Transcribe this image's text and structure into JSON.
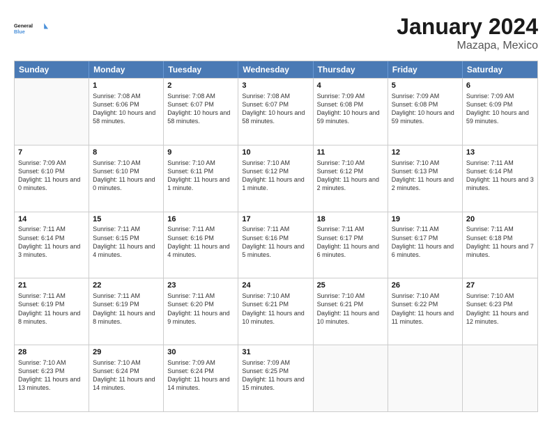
{
  "header": {
    "logo_general": "General",
    "logo_blue": "Blue",
    "main_title": "January 2024",
    "sub_title": "Mazapa, Mexico"
  },
  "days_of_week": [
    "Sunday",
    "Monday",
    "Tuesday",
    "Wednesday",
    "Thursday",
    "Friday",
    "Saturday"
  ],
  "weeks": [
    [
      {
        "day": "",
        "empty": true
      },
      {
        "day": "1",
        "sunrise": "Sunrise: 7:08 AM",
        "sunset": "Sunset: 6:06 PM",
        "daylight": "Daylight: 10 hours and 58 minutes."
      },
      {
        "day": "2",
        "sunrise": "Sunrise: 7:08 AM",
        "sunset": "Sunset: 6:07 PM",
        "daylight": "Daylight: 10 hours and 58 minutes."
      },
      {
        "day": "3",
        "sunrise": "Sunrise: 7:08 AM",
        "sunset": "Sunset: 6:07 PM",
        "daylight": "Daylight: 10 hours and 58 minutes."
      },
      {
        "day": "4",
        "sunrise": "Sunrise: 7:09 AM",
        "sunset": "Sunset: 6:08 PM",
        "daylight": "Daylight: 10 hours and 59 minutes."
      },
      {
        "day": "5",
        "sunrise": "Sunrise: 7:09 AM",
        "sunset": "Sunset: 6:08 PM",
        "daylight": "Daylight: 10 hours and 59 minutes."
      },
      {
        "day": "6",
        "sunrise": "Sunrise: 7:09 AM",
        "sunset": "Sunset: 6:09 PM",
        "daylight": "Daylight: 10 hours and 59 minutes."
      }
    ],
    [
      {
        "day": "7",
        "sunrise": "Sunrise: 7:09 AM",
        "sunset": "Sunset: 6:10 PM",
        "daylight": "Daylight: 11 hours and 0 minutes."
      },
      {
        "day": "8",
        "sunrise": "Sunrise: 7:10 AM",
        "sunset": "Sunset: 6:10 PM",
        "daylight": "Daylight: 11 hours and 0 minutes."
      },
      {
        "day": "9",
        "sunrise": "Sunrise: 7:10 AM",
        "sunset": "Sunset: 6:11 PM",
        "daylight": "Daylight: 11 hours and 1 minute."
      },
      {
        "day": "10",
        "sunrise": "Sunrise: 7:10 AM",
        "sunset": "Sunset: 6:12 PM",
        "daylight": "Daylight: 11 hours and 1 minute."
      },
      {
        "day": "11",
        "sunrise": "Sunrise: 7:10 AM",
        "sunset": "Sunset: 6:12 PM",
        "daylight": "Daylight: 11 hours and 2 minutes."
      },
      {
        "day": "12",
        "sunrise": "Sunrise: 7:10 AM",
        "sunset": "Sunset: 6:13 PM",
        "daylight": "Daylight: 11 hours and 2 minutes."
      },
      {
        "day": "13",
        "sunrise": "Sunrise: 7:11 AM",
        "sunset": "Sunset: 6:14 PM",
        "daylight": "Daylight: 11 hours and 3 minutes."
      }
    ],
    [
      {
        "day": "14",
        "sunrise": "Sunrise: 7:11 AM",
        "sunset": "Sunset: 6:14 PM",
        "daylight": "Daylight: 11 hours and 3 minutes."
      },
      {
        "day": "15",
        "sunrise": "Sunrise: 7:11 AM",
        "sunset": "Sunset: 6:15 PM",
        "daylight": "Daylight: 11 hours and 4 minutes."
      },
      {
        "day": "16",
        "sunrise": "Sunrise: 7:11 AM",
        "sunset": "Sunset: 6:16 PM",
        "daylight": "Daylight: 11 hours and 4 minutes."
      },
      {
        "day": "17",
        "sunrise": "Sunrise: 7:11 AM",
        "sunset": "Sunset: 6:16 PM",
        "daylight": "Daylight: 11 hours and 5 minutes."
      },
      {
        "day": "18",
        "sunrise": "Sunrise: 7:11 AM",
        "sunset": "Sunset: 6:17 PM",
        "daylight": "Daylight: 11 hours and 6 minutes."
      },
      {
        "day": "19",
        "sunrise": "Sunrise: 7:11 AM",
        "sunset": "Sunset: 6:17 PM",
        "daylight": "Daylight: 11 hours and 6 minutes."
      },
      {
        "day": "20",
        "sunrise": "Sunrise: 7:11 AM",
        "sunset": "Sunset: 6:18 PM",
        "daylight": "Daylight: 11 hours and 7 minutes."
      }
    ],
    [
      {
        "day": "21",
        "sunrise": "Sunrise: 7:11 AM",
        "sunset": "Sunset: 6:19 PM",
        "daylight": "Daylight: 11 hours and 8 minutes."
      },
      {
        "day": "22",
        "sunrise": "Sunrise: 7:11 AM",
        "sunset": "Sunset: 6:19 PM",
        "daylight": "Daylight: 11 hours and 8 minutes."
      },
      {
        "day": "23",
        "sunrise": "Sunrise: 7:11 AM",
        "sunset": "Sunset: 6:20 PM",
        "daylight": "Daylight: 11 hours and 9 minutes."
      },
      {
        "day": "24",
        "sunrise": "Sunrise: 7:10 AM",
        "sunset": "Sunset: 6:21 PM",
        "daylight": "Daylight: 11 hours and 10 minutes."
      },
      {
        "day": "25",
        "sunrise": "Sunrise: 7:10 AM",
        "sunset": "Sunset: 6:21 PM",
        "daylight": "Daylight: 11 hours and 10 minutes."
      },
      {
        "day": "26",
        "sunrise": "Sunrise: 7:10 AM",
        "sunset": "Sunset: 6:22 PM",
        "daylight": "Daylight: 11 hours and 11 minutes."
      },
      {
        "day": "27",
        "sunrise": "Sunrise: 7:10 AM",
        "sunset": "Sunset: 6:23 PM",
        "daylight": "Daylight: 11 hours and 12 minutes."
      }
    ],
    [
      {
        "day": "28",
        "sunrise": "Sunrise: 7:10 AM",
        "sunset": "Sunset: 6:23 PM",
        "daylight": "Daylight: 11 hours and 13 minutes."
      },
      {
        "day": "29",
        "sunrise": "Sunrise: 7:10 AM",
        "sunset": "Sunset: 6:24 PM",
        "daylight": "Daylight: 11 hours and 14 minutes."
      },
      {
        "day": "30",
        "sunrise": "Sunrise: 7:09 AM",
        "sunset": "Sunset: 6:24 PM",
        "daylight": "Daylight: 11 hours and 14 minutes."
      },
      {
        "day": "31",
        "sunrise": "Sunrise: 7:09 AM",
        "sunset": "Sunset: 6:25 PM",
        "daylight": "Daylight: 11 hours and 15 minutes."
      },
      {
        "day": "",
        "empty": true
      },
      {
        "day": "",
        "empty": true
      },
      {
        "day": "",
        "empty": true
      }
    ]
  ]
}
